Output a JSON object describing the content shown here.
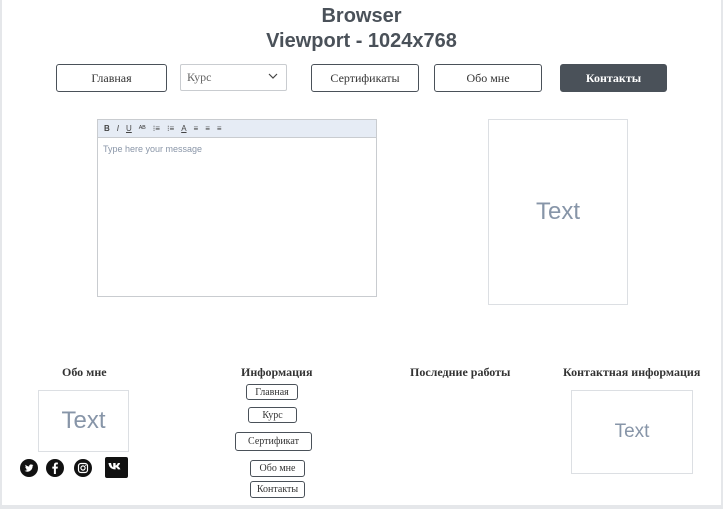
{
  "header": {
    "title_line1": "Browser",
    "title_line2": "Viewport - 1024x768"
  },
  "nav": {
    "home": "Главная",
    "course_select": {
      "selected": "Курс"
    },
    "certificates": "Сертификаты",
    "about": "Обо мне",
    "contacts": "Контакты"
  },
  "editor": {
    "toolbar": [
      "B",
      "I",
      "U",
      "ᴬᴮ",
      "⁝≡",
      "⁝≡",
      "A",
      "≡",
      "≡",
      "≡"
    ],
    "placeholder": "Type here your message"
  },
  "main_text_box": "Text",
  "footer": {
    "about": {
      "heading": "Обо мне",
      "text_box": "Text"
    },
    "info": {
      "heading": "Информация",
      "links": [
        "Главная",
        "Курс",
        "Сертификат",
        "Обо мне",
        "Контакты"
      ]
    },
    "recent": {
      "heading": "Последние работы"
    },
    "contact": {
      "heading": "Контактная информация",
      "text_box": "Text"
    }
  },
  "social": [
    "twitter-icon",
    "facebook-icon",
    "instagram-icon",
    "vk-icon"
  ],
  "colors": {
    "dark": "#4a5159",
    "border": "#c9ccd0",
    "placeholder": "#8795a8",
    "toolbar_bg": "#e6ecf5"
  }
}
